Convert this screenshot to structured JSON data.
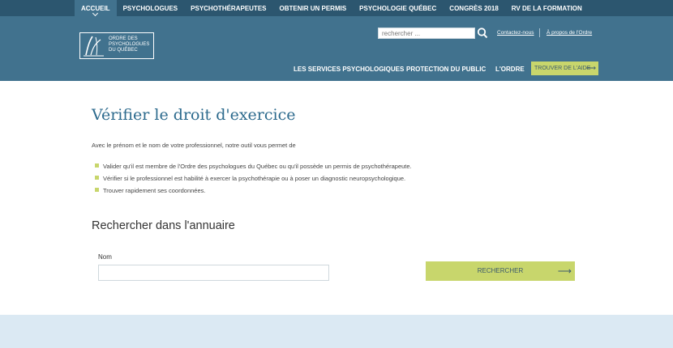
{
  "colors": {
    "topbar": "#2c566f",
    "header": "#41728e",
    "accent": "#c8d66c",
    "title": "#2c6a8d",
    "footer": "#dbe9f3"
  },
  "topnav": {
    "items": [
      {
        "label": "ACCUEIL"
      },
      {
        "label": "PSYCHOLOGUES"
      },
      {
        "label": "PSYCHOTHÉRAPEUTES"
      },
      {
        "label": "OBTENIR UN PERMIS"
      },
      {
        "label": "PSYCHOLOGIE QUÉBEC"
      },
      {
        "label": "CONGRÈS 2018"
      },
      {
        "label": "RV DE LA FORMATION"
      }
    ]
  },
  "logo": {
    "text": "ORDRE DES\nPSYCHOLOGUES\nDU QUÉBEC"
  },
  "header": {
    "search_placeholder": "rechercher ...",
    "search_icon": "search-icon",
    "contact_label": "Contactez-nous",
    "about_label": "À propos de l'Ordre",
    "nav": [
      {
        "label": "LES SERVICES PSYCHOLOGIQUES"
      },
      {
        "label": "PROTECTION DU PUBLIC"
      },
      {
        "label": "L'ORDRE"
      }
    ],
    "aide_label": "TROUVER DE L'AIDE",
    "arrow": "⟶"
  },
  "main": {
    "title": "Vérifier le droit d'exercice",
    "intro": "Avec le prénom et le nom de votre professionnel, notre outil vous permet de",
    "bullets": [
      "Valider qu'il est membre de l'Ordre des psychologues du Québec ou qu'il possède un permis de psychothérapeute.",
      "Vérifier si le professionnel est habilité à exercer la psychothérapie ou à poser un diagnostic neuropsychologique.",
      "Trouver rapidement ses coordonnées."
    ],
    "search_heading": "Rechercher dans l'annuaire",
    "name_label": "Nom",
    "name_value": "",
    "search_button": "RECHERCHER",
    "arrow": "⟶"
  }
}
